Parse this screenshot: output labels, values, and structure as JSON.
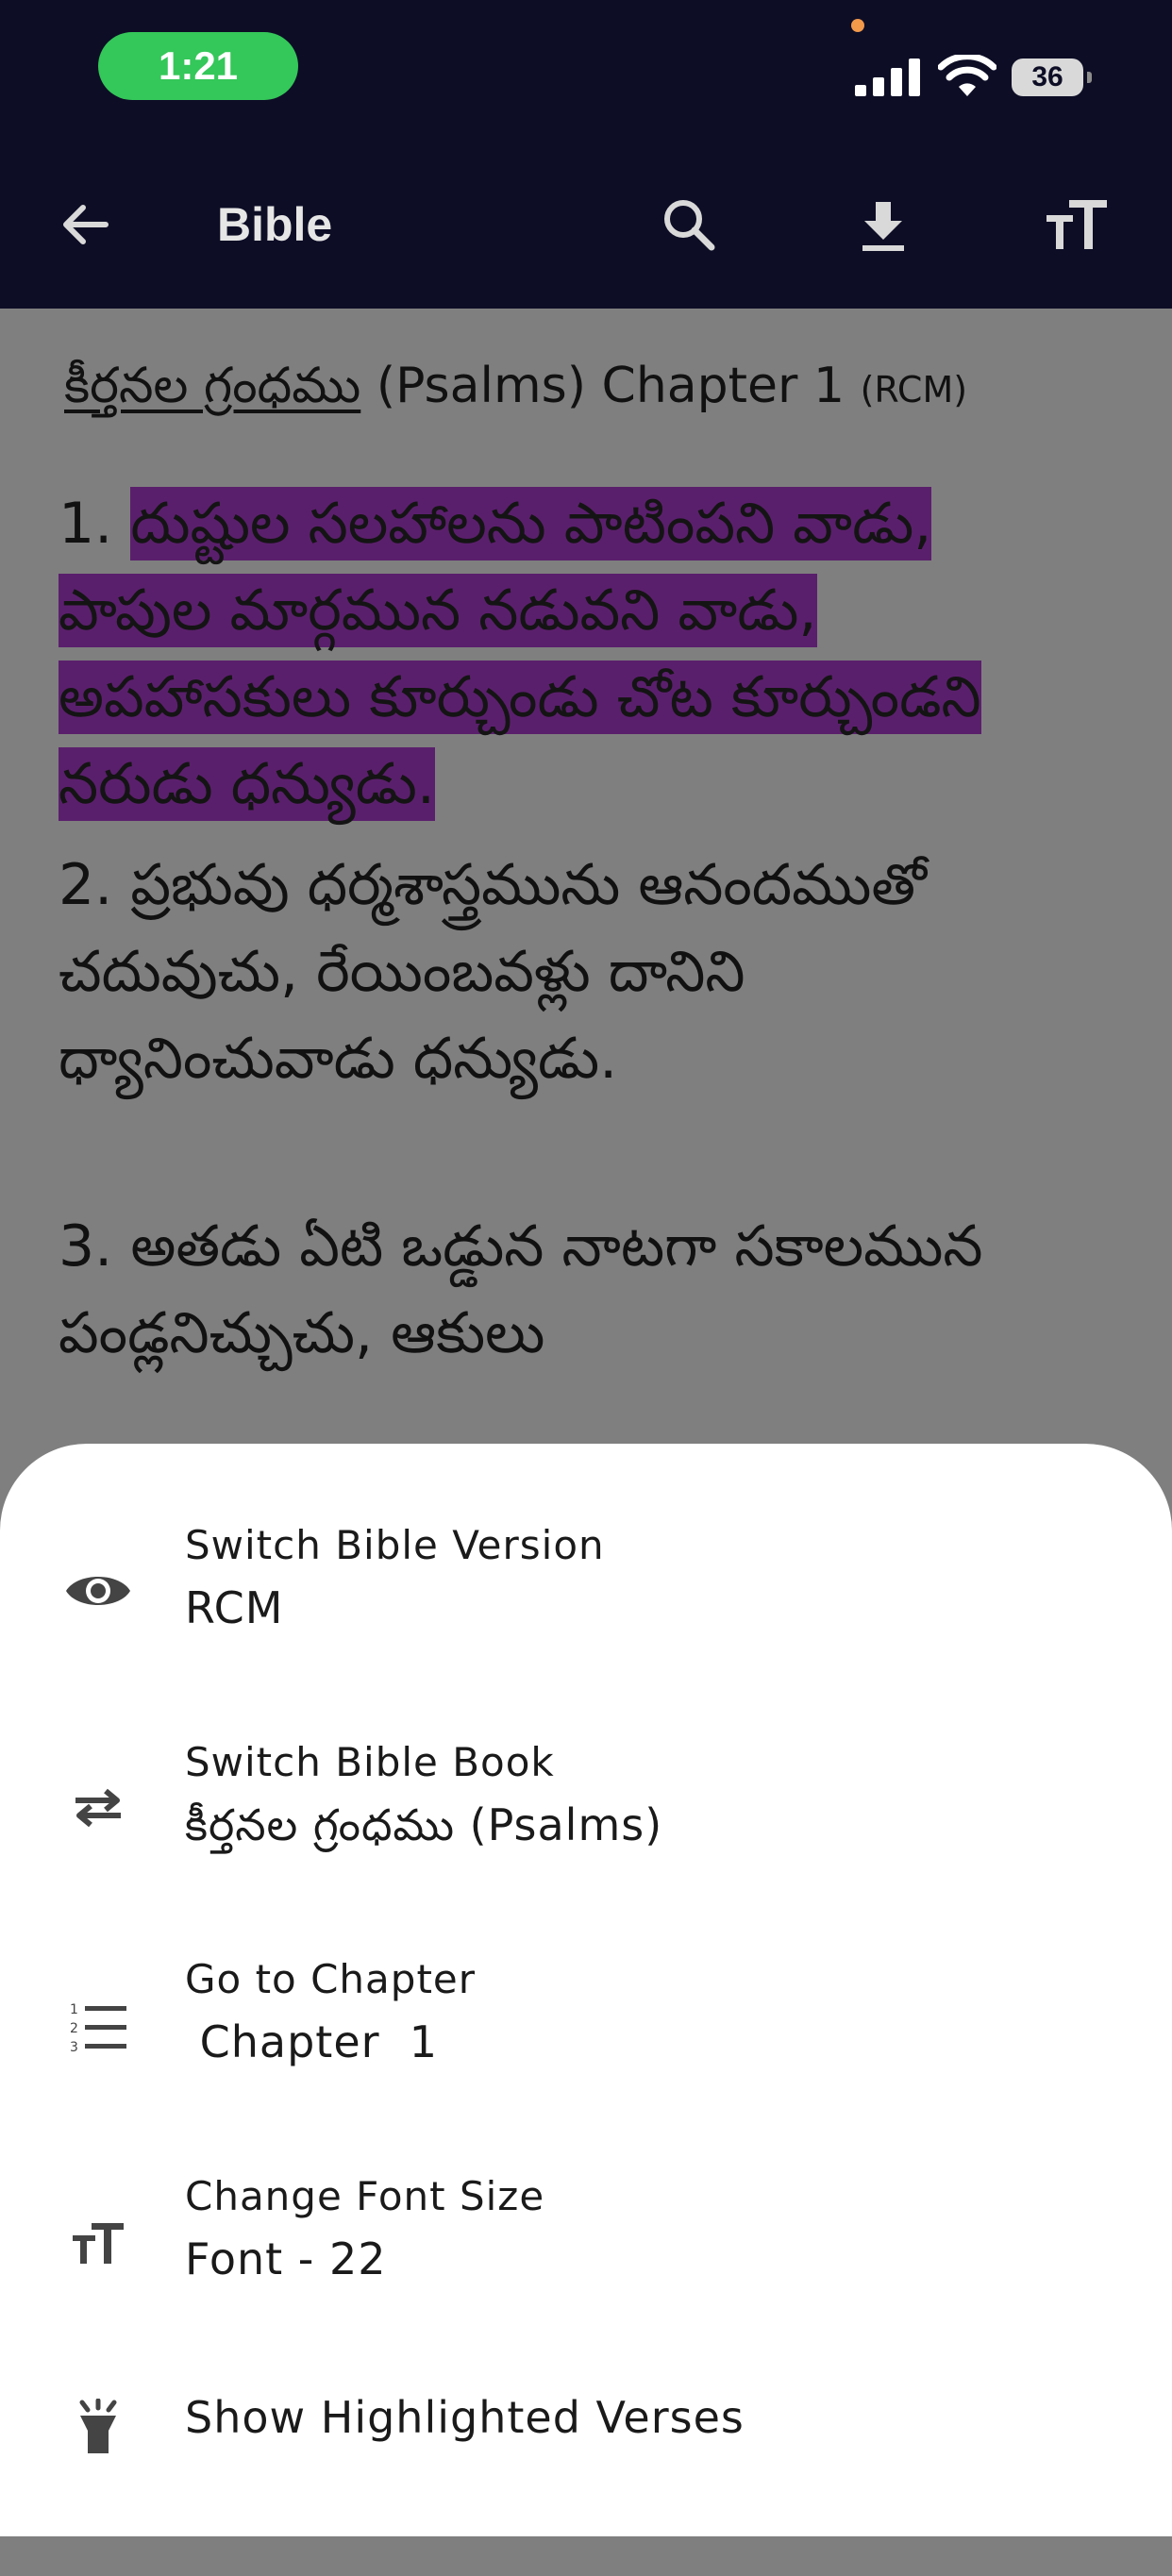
{
  "status_bar": {
    "time": "1:21",
    "battery": "36"
  },
  "app_bar": {
    "title": "Bible",
    "icons": [
      "back-arrow-icon",
      "search-icon",
      "download-icon",
      "font-size-icon"
    ]
  },
  "reader": {
    "heading": {
      "book": "కీర్తనల గ్రంధము",
      "rest": " (Psalms) Chapter 1 ",
      "version": "(RCM)"
    },
    "verses": [
      {
        "number": "1.",
        "text": "దుష్టుల సలహాలను పాటింపని వాడు, పాపుల మార్గమున నడువని వాడు, అపహాసకులు కూర్చుండు చోట కూర్చుండని నరుడు ధన్యుడు.",
        "highlighted": true
      },
      {
        "number": "2.",
        "text": "ప్రభువు ధర్మశాస్త్రమును ఆనందముతో చదువుచు, రేయింబవళ్లు దానిని ధ్యానించువాడు ధన్యుడు.",
        "highlighted": false
      },
      {
        "number": "3.",
        "text": "అతడు ఏటి ఒడ్డున నాటగా సకాలమున పండ్లనిచ్చుచు, ఆకులు",
        "highlighted": false
      }
    ],
    "highlight_color": "#5a1f6c"
  },
  "sheet": {
    "items": [
      {
        "icon": "eye-icon",
        "label": "Switch Bible Version",
        "value": "RCM"
      },
      {
        "icon": "swap-arrows-icon",
        "label": "Switch Bible Book",
        "value": "కీర్తనల గ్రంధము (Psalms)"
      },
      {
        "icon": "numbered-list-icon",
        "label": "Go to Chapter",
        "value": " Chapter  1"
      },
      {
        "icon": "font-size-icon",
        "label": "Change Font Size",
        "value": "Font - 22"
      },
      {
        "icon": "highlight-marker-icon",
        "label": "Show Highlighted Verses"
      }
    ]
  },
  "colors": {
    "app_bar_bg": "#0d0d26",
    "overlay_bg": "#7f7f7f",
    "time_pill": "#34c759",
    "sheet_bg": "#ffffff"
  }
}
